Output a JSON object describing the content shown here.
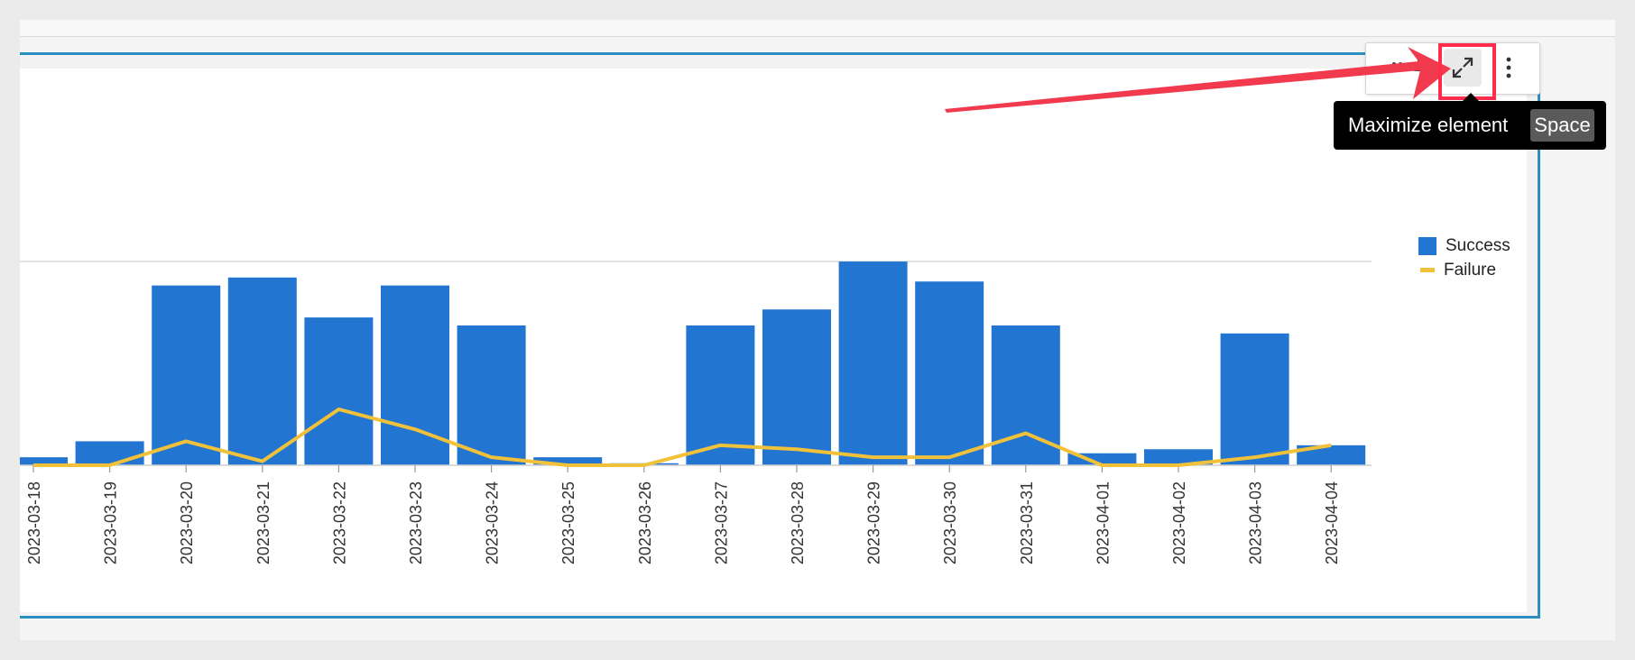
{
  "toolbar": {
    "buttons": [
      {
        "name": "drag-handle-icon"
      },
      {
        "name": "pin-icon"
      },
      {
        "name": "maximize-icon",
        "active": true
      },
      {
        "name": "more-options-icon"
      }
    ]
  },
  "tooltip": {
    "label": "Maximize element",
    "shortcut": "Space"
  },
  "annotation": {
    "arrow_color": "#f23a4f",
    "highlight_color": "#ff2d4b"
  },
  "colors": {
    "success": "#2275d0",
    "failure": "#f2c13a",
    "frame_border": "#2b8fc2"
  },
  "chart_data": {
    "type": "bar",
    "categories": [
      "2023-03-18",
      "2023-03-19",
      "2023-03-20",
      "2023-03-21",
      "2023-03-22",
      "2023-03-23",
      "2023-03-24",
      "2023-03-25",
      "2023-03-26",
      "2023-03-27",
      "2023-03-28",
      "2023-03-29",
      "2023-03-30",
      "2023-03-31",
      "2023-04-01",
      "2023-04-02",
      "2023-04-03",
      "2023-04-04"
    ],
    "series": [
      {
        "name": "Success",
        "type": "bar",
        "values": [
          2,
          6,
          45,
          47,
          37,
          45,
          35,
          2,
          0.5,
          35,
          39,
          51,
          46,
          35,
          3,
          4,
          33,
          5
        ]
      },
      {
        "name": "Failure",
        "type": "line",
        "values": [
          0,
          0,
          6,
          1,
          14,
          9,
          2,
          0,
          0,
          5,
          4,
          2,
          2,
          8,
          0,
          0,
          2,
          5
        ]
      }
    ],
    "ylim": [
      0,
      100
    ],
    "grid": true,
    "legend_position": "top-right"
  }
}
